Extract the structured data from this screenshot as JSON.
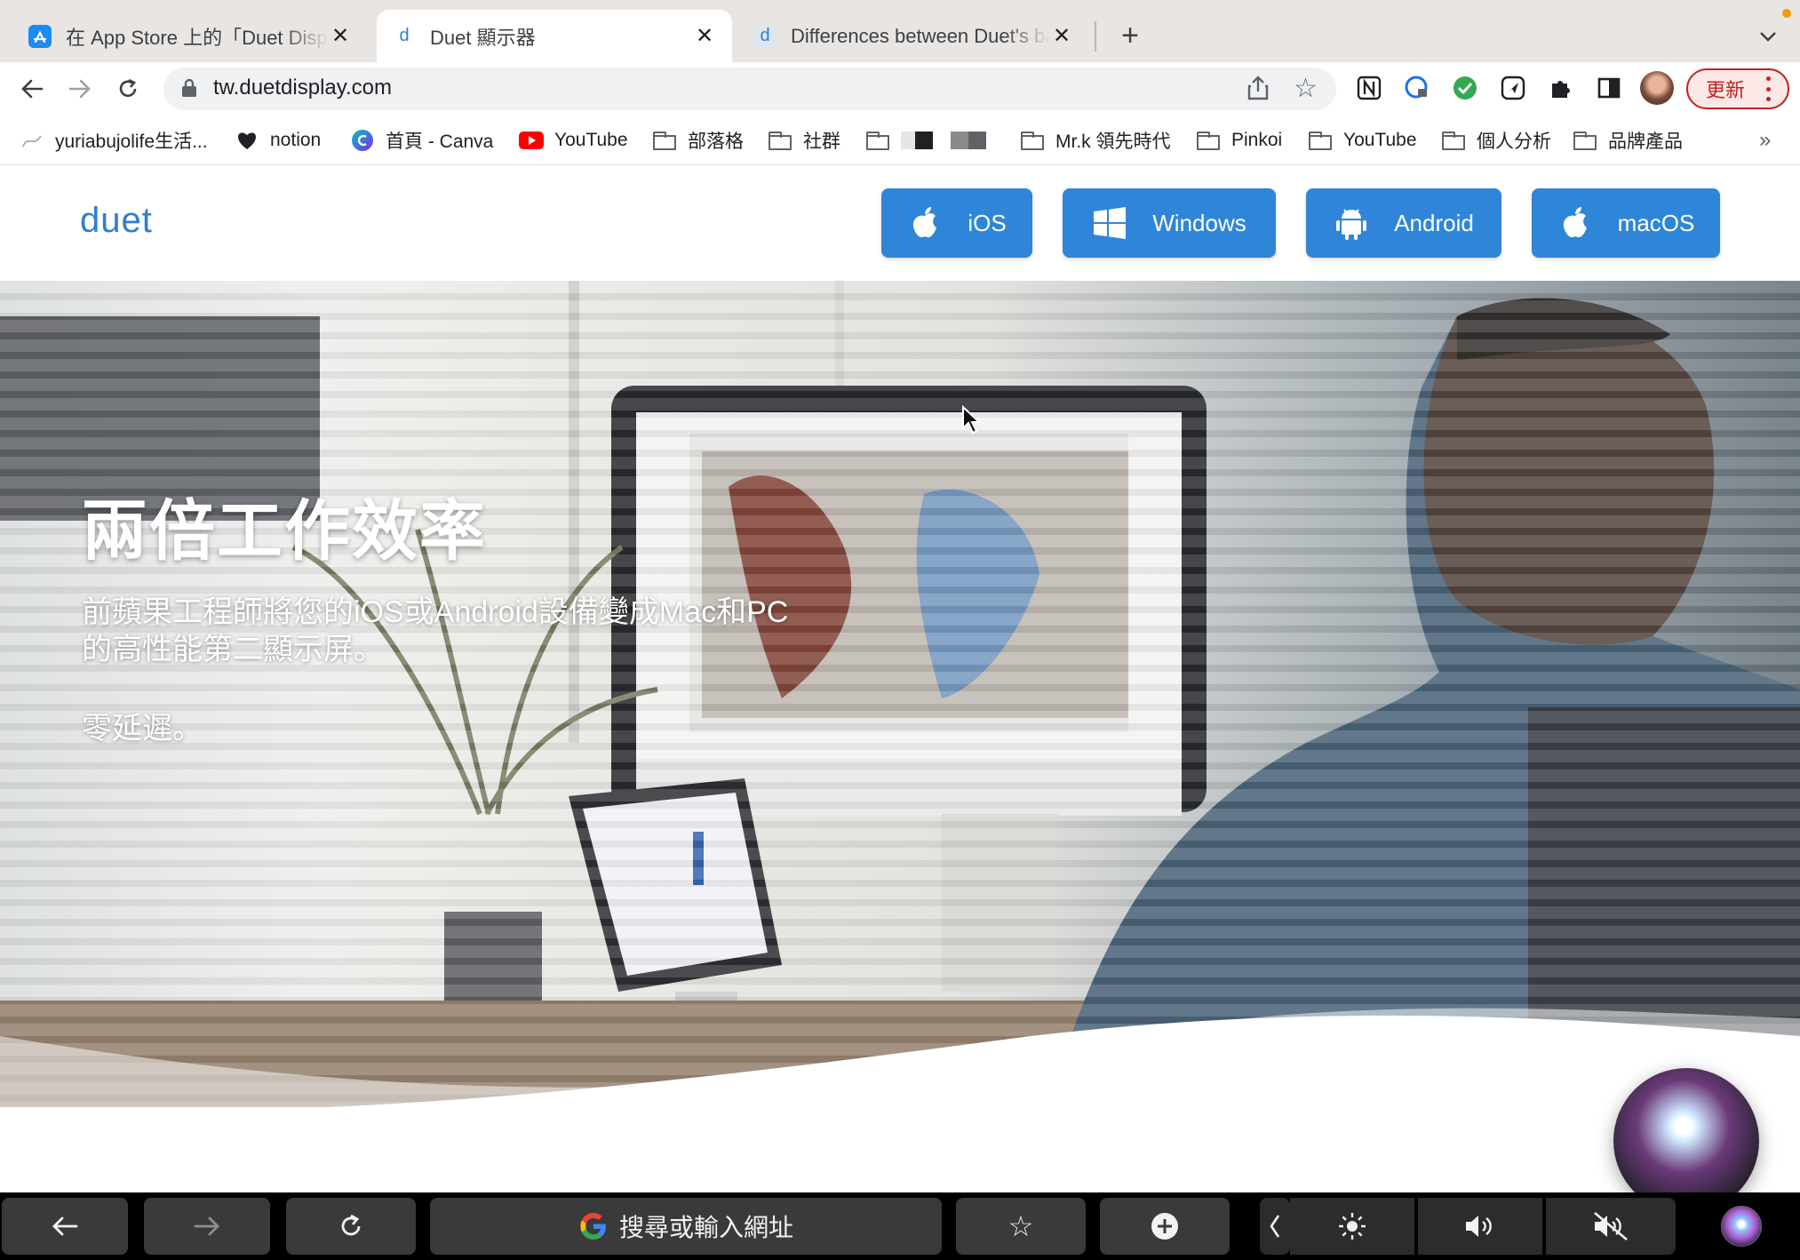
{
  "browser": {
    "tabs": [
      {
        "title": "在 App Store 上的「Duet Display」",
        "favicon": "app-store-icon",
        "active": false
      },
      {
        "title": "Duet 顯示器",
        "favicon": "duet-icon",
        "active": true
      },
      {
        "title": "Differences between Duet's ba",
        "favicon": "duet-icon",
        "active": false
      }
    ],
    "url": "tw.duetdisplay.com",
    "update_label": "更新",
    "bookmarks": [
      {
        "label": "yuriabujolife生活...",
        "icon": "yuri-icon"
      },
      {
        "label": "notion",
        "icon": "heart-icon"
      },
      {
        "label": "首頁 - Canva",
        "icon": "canva-icon"
      },
      {
        "label": "YouTube",
        "icon": "youtube-icon"
      },
      {
        "label": "部落格",
        "icon": "folder-icon"
      },
      {
        "label": "社群",
        "icon": "folder-icon"
      },
      {
        "label": "",
        "icon": "folder-icon"
      },
      {
        "label": "Mr.k 領先時代",
        "icon": "folder-icon"
      },
      {
        "label": "Pinkoi",
        "icon": "folder-icon"
      },
      {
        "label": "YouTube",
        "icon": "folder-icon"
      },
      {
        "label": "個人分析",
        "icon": "folder-icon"
      },
      {
        "label": "品牌產品",
        "icon": "folder-icon"
      }
    ],
    "overflow": "»"
  },
  "site": {
    "logo": "duet",
    "platform_buttons": [
      {
        "label": "iOS",
        "icon": "apple-icon"
      },
      {
        "label": "Windows",
        "icon": "windows-icon"
      },
      {
        "label": "Android",
        "icon": "android-icon"
      },
      {
        "label": "macOS",
        "icon": "apple-icon"
      }
    ],
    "hero": {
      "title": "兩倍工作效率",
      "subtitle": "前蘋果工程師將您的iOS或Android設備變成Mac和PC的高性能第二顯示屏。",
      "subtitle2": "零延遲。"
    }
  },
  "touchbar": {
    "search_placeholder": "搜尋或輸入網址"
  },
  "colors": {
    "brand_blue": "#2f86d8",
    "update_red": "#c5221f"
  }
}
